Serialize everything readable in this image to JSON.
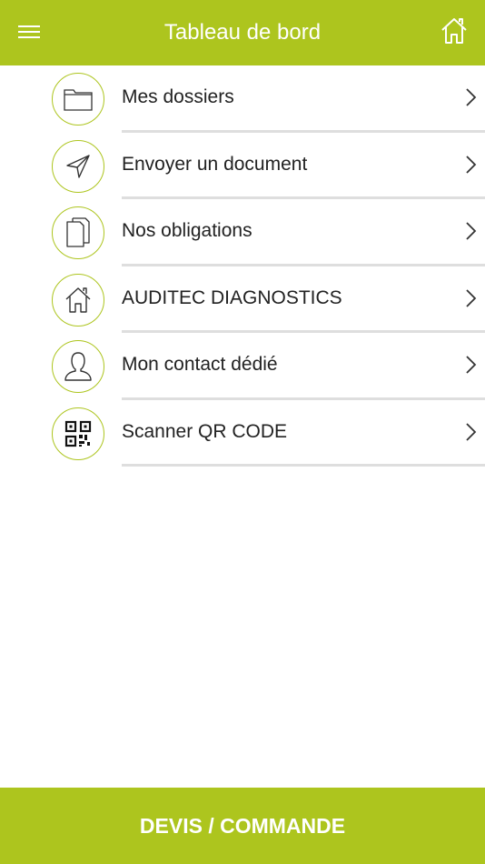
{
  "header": {
    "title": "Tableau de bord",
    "menu_icon": "hamburger-menu-icon",
    "home_icon": "home-icon"
  },
  "menu": {
    "items": [
      {
        "label": "Mes dossiers",
        "icon": "folder-icon"
      },
      {
        "label": "Envoyer un document",
        "icon": "send-icon"
      },
      {
        "label": "Nos obligations",
        "icon": "documents-icon"
      },
      {
        "label": "AUDITEC DIAGNOSTICS",
        "icon": "house-icon"
      },
      {
        "label": "Mon contact dédié",
        "icon": "person-icon"
      },
      {
        "label": "Scanner QR CODE",
        "icon": "qr-code-icon"
      }
    ]
  },
  "footer": {
    "button_label": "DEVIS / COMMANDE"
  },
  "colors": {
    "accent": "#adc51e",
    "text": "#222222",
    "separator": "#dedede"
  }
}
